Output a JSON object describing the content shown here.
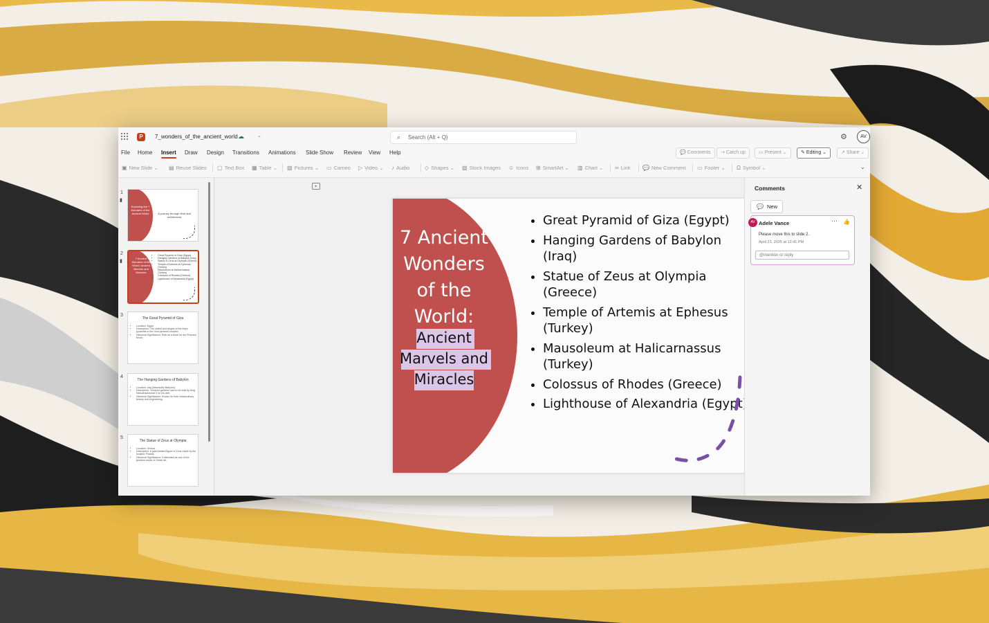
{
  "app": {
    "file_name": "7_wonders_of_the_ancient_world",
    "logo_letter": "P",
    "search_placeholder": "Search (Alt + Q)",
    "user_initials": "AV",
    "accent": "#c43e1c"
  },
  "menu": {
    "tabs": [
      "File",
      "Home",
      "Insert",
      "Draw",
      "Design",
      "Transitions",
      "Animations",
      "Slide Show",
      "Review",
      "View",
      "Help"
    ],
    "active_tab": "Insert",
    "comments_btn": "Comments",
    "catchup_btn": "Catch up",
    "present_btn": "Present",
    "editing_btn": "Editing",
    "share_btn": "Share"
  },
  "ribbon": {
    "new_slide": "New Slide",
    "reuse_slides": "Reuse Slides",
    "text_box": "Text Box",
    "table": "Table",
    "pictures": "Pictures",
    "cameo": "Cameo",
    "video": "Video",
    "audio": "Audio",
    "shapes": "Shapes",
    "stock_images": "Stock Images",
    "icons": "Icons",
    "smartart": "SmartArt",
    "chart": "Chart",
    "link": "Link",
    "new_comment": "New Comment",
    "footer": "Footer",
    "symbol": "Symbol"
  },
  "thumbnails": [
    {
      "number": "1",
      "title": "Exploring the 7 Wonders of the Ancient World",
      "subtitle": "A journey through time and architecture"
    },
    {
      "number": "2",
      "title": "7 Ancient Wonders of the World: Ancient Marvels and Miracles",
      "bullets": [
        "Great Pyramid of Giza (Egypt)",
        "Hanging Gardens of Babylon (Iraq)",
        "Statue of Zeus at Olympia (Greece)",
        "Temple of Artemis at Ephesus (Turkey)",
        "Mausoleum at Halicarnassus (Turkey)",
        "Colossus of Rhodes (Greece)",
        "Lighthouse of Alexandria (Egypt)"
      ]
    },
    {
      "number": "3",
      "title": "The Great Pyramid of Giza",
      "bullets": [
        "Location: Egypt",
        "Description: The oldest and largest of the three pyramids in the Giza pyramid complex.",
        "Historical Significance: Built as a tomb for the Pharaoh Khufu."
      ]
    },
    {
      "number": "4",
      "title": "The Hanging Gardens of Babylon",
      "bullets": [
        "Location: Iraq (historically Babylon)",
        "Description: Terraced gardens said to be built by King Nebuchadnezzar II for his wife.",
        "Historical Significance: Known for their extraordinary beauty and engineering."
      ]
    },
    {
      "number": "5",
      "title": "The Statue of Zeus at Olympia",
      "bullets": [
        "Location: Greece",
        "Description: A giant seated figure of Zeus made by the sculptor Phidias.",
        "Historical Significance: Celebrated as one of the greatest works of Greek art."
      ]
    }
  ],
  "slide": {
    "title_line1": "7 Ancient",
    "title_line2": "Wonders",
    "title_line3": "of the",
    "title_line4": "World:",
    "sub_line1": "Ancient",
    "sub_line2": "Marvels and",
    "sub_line3": "Miracles",
    "bullets": [
      "Great Pyramid of Giza (Egypt)",
      "Hanging Gardens of Babylon (Iraq)",
      "Statue of Zeus at Olympia (Greece)",
      "Temple of Artemis at Ephesus (Turkey)",
      "Mausoleum at Halicarnassus (Turkey)",
      "Colossus of Rhodes (Greece)",
      "Lighthouse of Alexandria (Egypt)"
    ],
    "accent_color": "#c0504d",
    "highlight_color": "#dcc6e8",
    "arc_color": "#7b4fa6"
  },
  "comments": {
    "title": "Comments",
    "new_label": "New",
    "card": {
      "initials": "AV",
      "author": "Adele Vance",
      "text": "Please move this to slide 2.",
      "date": "April 23, 2025 at 12:41 PM",
      "reply_placeholder": "@mention or reply"
    }
  }
}
